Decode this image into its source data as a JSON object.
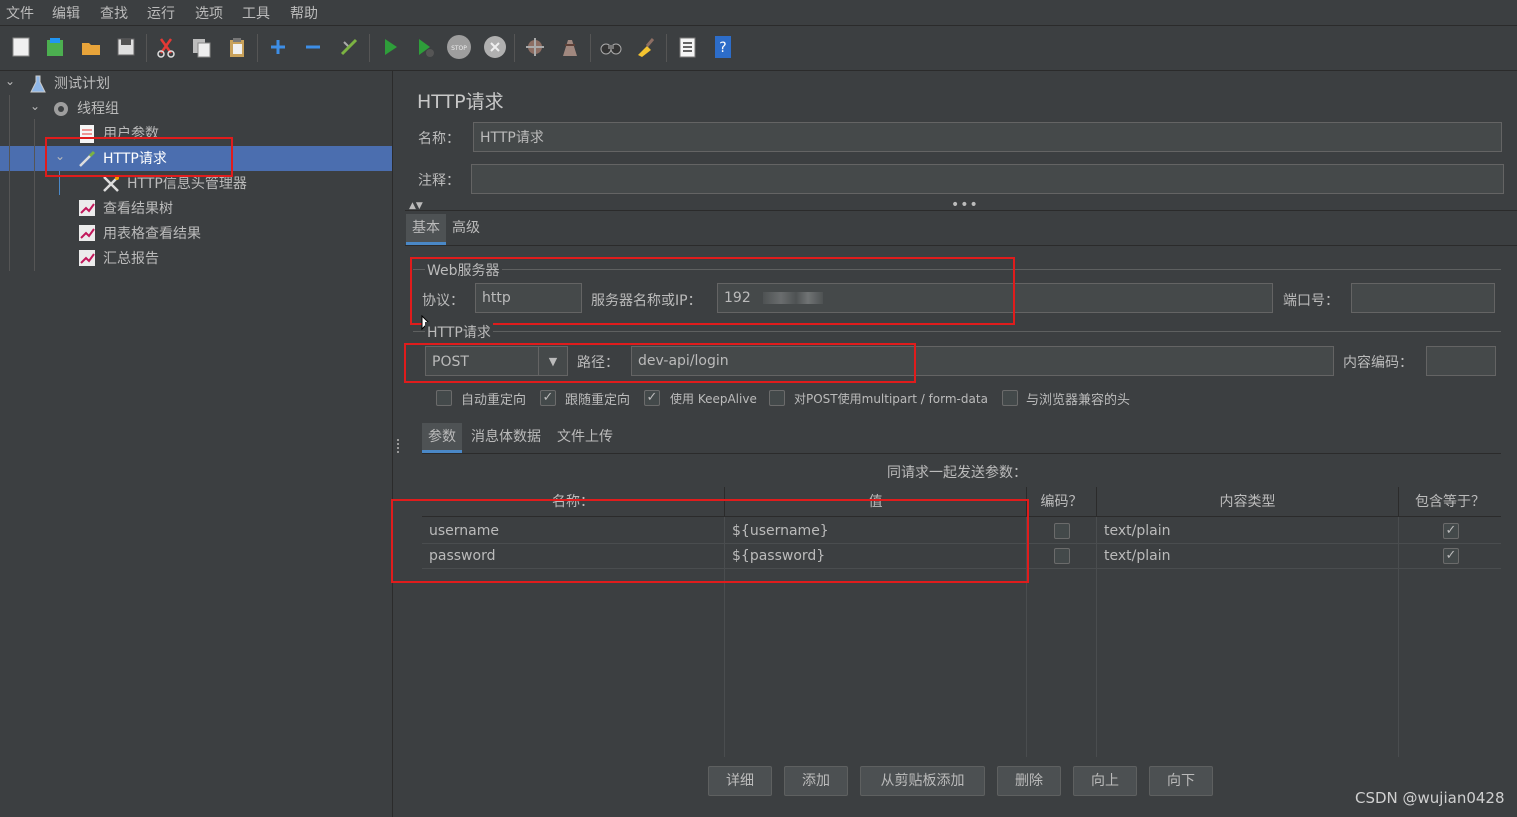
{
  "menu": [
    "文件",
    "编辑",
    "查找",
    "运行",
    "选项",
    "工具",
    "帮助"
  ],
  "tree": {
    "items": [
      {
        "label": "测试计划"
      },
      {
        "label": "线程组"
      },
      {
        "label": "用户参数"
      },
      {
        "label": "HTTP请求"
      },
      {
        "label": "HTTP信息头管理器"
      },
      {
        "label": "查看结果树"
      },
      {
        "label": "用表格查看结果"
      },
      {
        "label": "汇总报告"
      }
    ]
  },
  "panel": {
    "title": "HTTP请求",
    "name_label": "名称：",
    "name_value": "HTTP请求",
    "comment_label": "注释：",
    "comment_value": "",
    "tabs": [
      "基本",
      "高级"
    ],
    "web_server": {
      "legend": "Web服务器",
      "protocol_label": "协议：",
      "protocol_value": "http",
      "server_label": "服务器名称或IP：",
      "server_value": "192",
      "port_label": "端口号：",
      "port_value": ""
    },
    "http_request": {
      "legend": "HTTP请求",
      "method": "POST",
      "path_label": "路径：",
      "path_value": "dev-api/login",
      "encoding_label": "内容编码：",
      "encoding_value": ""
    },
    "options": [
      {
        "label": "自动重定向",
        "checked": false
      },
      {
        "label": "跟随重定向",
        "checked": true
      },
      {
        "label": "使用 KeepAlive",
        "checked": true
      },
      {
        "label": "对POST使用multipart / form-data",
        "checked": false
      },
      {
        "label": "与浏览器兼容的头",
        "checked": false
      }
    ],
    "sub_tabs": [
      "参数",
      "消息体数据",
      "文件上传"
    ],
    "params_caption": "同请求一起发送参数：",
    "table": {
      "headers": [
        "名称：",
        "值",
        "编码？",
        "内容类型",
        "包含等于？"
      ],
      "rows": [
        {
          "name": "username",
          "value": "${username}",
          "encode": false,
          "content_type": "text/plain",
          "include_equals": true
        },
        {
          "name": "password",
          "value": "${password}",
          "encode": false,
          "content_type": "text/plain",
          "include_equals": true
        }
      ]
    },
    "buttons": [
      "详细",
      "添加",
      "从剪贴板添加",
      "删除",
      "向上",
      "向下"
    ]
  },
  "watermark": "CSDN @wujian0428",
  "colors": {
    "background": "#3c3f41",
    "selection": "#4b6eaf",
    "highlight_box": "#e01c1c"
  }
}
